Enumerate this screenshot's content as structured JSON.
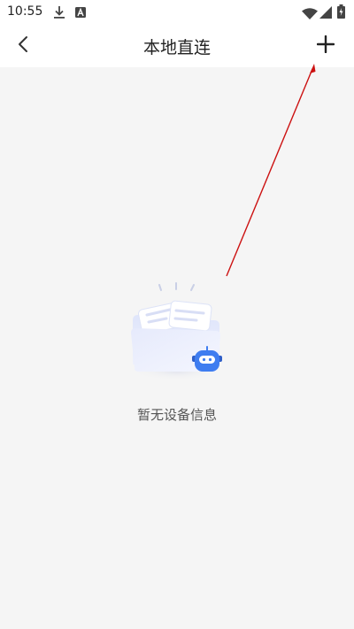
{
  "status_bar": {
    "time": "10:55",
    "icons": [
      "download-icon",
      "a-notification-icon",
      "wifi-icon",
      "signal-icon",
      "battery-icon"
    ]
  },
  "app_bar": {
    "title": "本地直连",
    "back_icon": "chevron-left-icon",
    "add_icon": "plus-icon"
  },
  "empty_state": {
    "message": "暂无设备信息",
    "illustration": "empty-folder-robot-illustration"
  },
  "colors": {
    "background": "#f5f5f5",
    "bar_background": "#ffffff",
    "title_text": "#222222",
    "empty_text": "#555555",
    "annotation_arrow": "#cc1111",
    "robot_blue": "#3f7df0"
  }
}
